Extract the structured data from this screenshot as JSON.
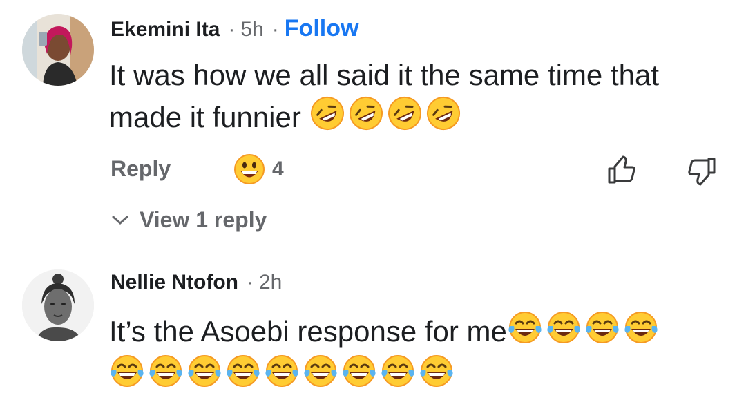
{
  "comments": [
    {
      "author": "Ekemini Ita",
      "separator": "·",
      "time": "5h",
      "follow_label": "Follow",
      "text_line1": "It was how we all said it the same time that",
      "text_line2": "made it funnier",
      "text_emoji": "rolling-on-the-floor-laughing",
      "text_emoji_count": 4,
      "reply_label": "Reply",
      "reaction_emoji": "grinning-face",
      "reaction_count": "4",
      "view_replies_label": "View 1 reply"
    },
    {
      "author": "Nellie Ntofon",
      "separator": "·",
      "time": "2h",
      "text_line1": "It’s the Asoebi response for me",
      "text_emoji": "face-with-tears-of-joy",
      "text_emoji_count_line1": 4,
      "text_emoji_count_line2": 9
    }
  ],
  "colors": {
    "name": "#1c1e21",
    "meta": "#65676b",
    "follow": "#1877f2",
    "emoji_yellow": "#ffcc33",
    "emoji_orange": "#f59a23"
  }
}
